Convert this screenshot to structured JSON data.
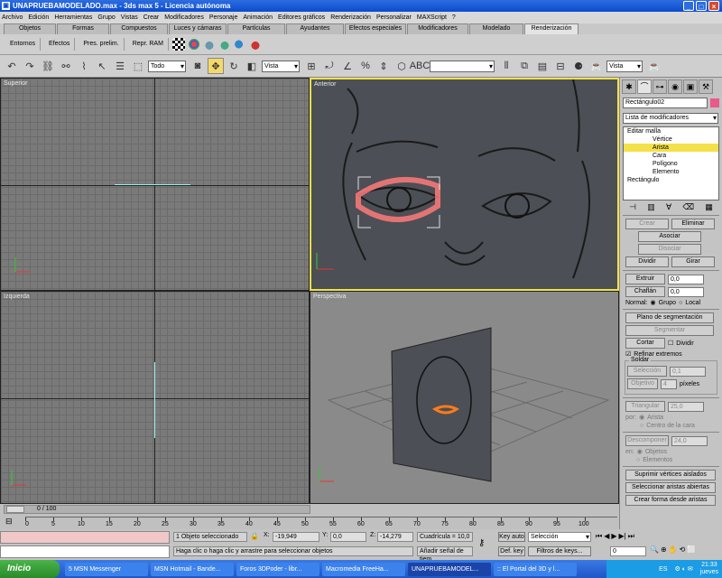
{
  "window": {
    "title": "UNAPRUEBAMODELADO.max - 3ds max 5 - Licencia autónoma"
  },
  "menu": [
    "Archivo",
    "Edición",
    "Herramientas",
    "Grupo",
    "Vistas",
    "Crear",
    "Modificadores",
    "Personaje",
    "Animación",
    "Editores gráficos",
    "Renderización",
    "Personalizar",
    "MAXScript",
    "?"
  ],
  "tabs": [
    {
      "label": "Objetos"
    },
    {
      "label": "Formas"
    },
    {
      "label": "Compuestos"
    },
    {
      "label": "Luces y cámaras"
    },
    {
      "label": "Partículas"
    },
    {
      "label": "Ayudantes"
    },
    {
      "label": "Efectos especiales"
    },
    {
      "label": "Modificadores"
    },
    {
      "label": "Modelado"
    },
    {
      "label": "Renderización"
    }
  ],
  "shelf": {
    "buttons": [
      "Entornos",
      "Efectos",
      "Pres. prelim.",
      "Repr. RAM"
    ]
  },
  "toolbar": {
    "filter": "Todo",
    "coord": "Vista",
    "view": "Vista"
  },
  "viewports": {
    "top": "Superior",
    "front": "Anterior",
    "left": "Izquierda",
    "persp": "Perspectiva"
  },
  "command_panel": {
    "object_name": "Rectángulo02",
    "modifier_list": "Lista de modificadores",
    "stack": [
      "Editar malla",
      "Vértice",
      "Arista",
      "Cara",
      "Polígono",
      "Elemento",
      "Rectángulo"
    ],
    "selected_stack_item": "Arista",
    "buttons": {
      "crear": "Crear",
      "eliminar": "Eliminar",
      "asociar": "Asociar",
      "disociar": "Disociar",
      "dividir": "Dividir",
      "girar": "Girar",
      "extruir": "Extruir",
      "chaflan": "Chaflán",
      "plano": "Plano de segmentación",
      "segmentar": "Segmentar",
      "cortar": "Cortar",
      "seleccion": "Selección",
      "objetivo": "Objetivo",
      "triangular": "Triangular",
      "descomponer": "Descomponer",
      "suprimir": "Suprimir vértices aislados",
      "seleccionar_abiertas": "Seleccionar aristas abiertas",
      "crear_forma": "Crear forma desde aristas"
    },
    "values": {
      "extruir": "0,0",
      "chaflan": "0,0",
      "seleccion": "0,1",
      "objetivo": "4",
      "triangular": "25,0",
      "descomponer": "24,0"
    },
    "labels": {
      "normal": "Normal:",
      "grupo": "Grupo",
      "local": "Local",
      "dividir_chk": "Dividir",
      "refinar": "Refinar extremos",
      "soldar": "Soldar",
      "pixeles": "píxeles",
      "por": "por:",
      "arista": "Arista",
      "centro": "Centro de la cara",
      "en": "en:",
      "objetos": "Objetos",
      "elementos": "Elementos"
    }
  },
  "timeline": {
    "frame": "0 / 100",
    "ticks": [
      "0",
      "5",
      "10",
      "15",
      "20",
      "25",
      "30",
      "35",
      "40",
      "45",
      "50",
      "55",
      "60",
      "65",
      "70",
      "75",
      "80",
      "85",
      "90",
      "95",
      "100"
    ]
  },
  "status": {
    "selected": "1 Objeto seleccionado",
    "hint": "Haga clic o haga clic y arrastre para seleccionar objetos",
    "x": "-19,949",
    "y": "0,0",
    "z": "-14,279",
    "grid": "Cuadrícula = 10,0",
    "time_tag": "Añadir señal de tiem",
    "key_auto": "Key auto",
    "set_key": "Def. key",
    "selection": "Selección",
    "key_filters": "Filtros de keys...",
    "frame_field": "0"
  },
  "taskbar": {
    "start": "Inicio",
    "items": [
      "5 MSN Messenger",
      "MSN Hotmail - Bande...",
      "Foros 3DPoder - libr...",
      "Macromedia FreeHa...",
      "UNAPRUEBAMODEL...",
      ":: El Portal del 3D y l..."
    ],
    "lang": "ES",
    "time": "21:33",
    "day": "jueves"
  }
}
